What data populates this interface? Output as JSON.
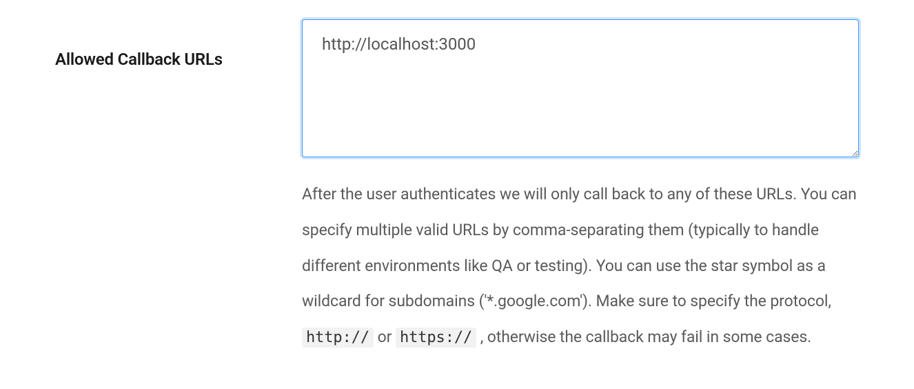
{
  "field": {
    "label": "Allowed Callback URLs",
    "value": "http://localhost:3000",
    "help_prefix": "After the user authenticates we will only call back to any of these URLs. You can specify multiple valid URLs by comma-separating them (typically to handle different environments like QA or testing). You can use the star symbol as a wildcard for subdomains ('*.google.com'). Make sure to specify the protocol, ",
    "help_code1": "http://",
    "help_or": " or ",
    "help_code2": "https://",
    "help_suffix": " , otherwise the callback may fail in some cases."
  }
}
